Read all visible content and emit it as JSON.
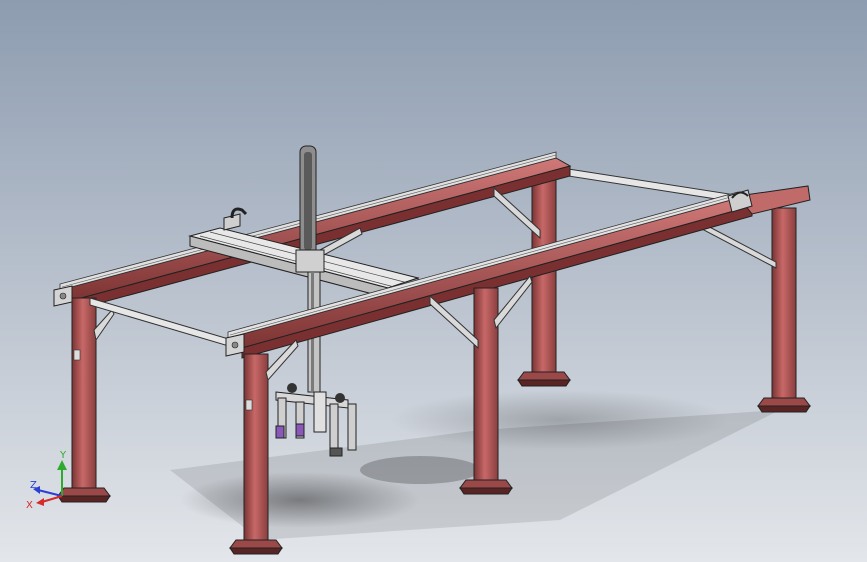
{
  "viewport": {
    "model": "gantry-robot-assembly",
    "background_top": "#8d9cb0",
    "background_bottom": "#e3e6ea"
  },
  "colors": {
    "steel_red": "#b85a5a",
    "steel_red_dark": "#6e2b2b",
    "rail_grey": "#c8c8c8",
    "edge_dark": "#1e1e1e"
  },
  "triad": {
    "y_label": "Y",
    "z_label": "Z",
    "x_label": "X",
    "y_color": "#2faa2f",
    "z_color": "#2b3fd6",
    "x_color": "#d62b2b"
  }
}
